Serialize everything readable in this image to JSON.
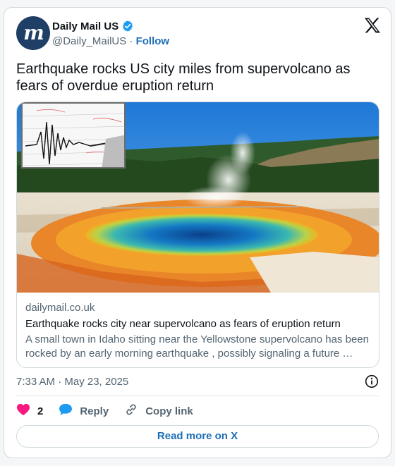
{
  "account": {
    "avatar_letter": "m",
    "name": "Daily Mail US",
    "handle": "@Daily_MailUS",
    "separator": "·",
    "follow_label": "Follow",
    "verified_color": "#1d9bf0",
    "avatar_color": "#1f3f66"
  },
  "tweet": {
    "text": "Earthquake rocks US city miles from supervolcano as fears of overdue eruption return"
  },
  "link_card": {
    "domain": "dailymail.co.uk",
    "title": "Earthquake rocks city near supervolcano as fears of eruption return",
    "description": "A small town in Idaho sitting near the Yellowstone supervolcano has been rocked by an early morning earthquake , possibly signaling a future …"
  },
  "meta": {
    "timestamp": "7:33 AM · May 23, 2025"
  },
  "actions": {
    "like_count": "2",
    "reply_label": "Reply",
    "copy_label": "Copy link",
    "like_color": "#f91880",
    "reply_color": "#1d9bf0"
  },
  "read_more_label": "Read more on X",
  "icons": [
    "verified-icon",
    "x-logo-icon",
    "info-icon",
    "heart-icon",
    "reply-bubble-icon",
    "link-icon"
  ]
}
